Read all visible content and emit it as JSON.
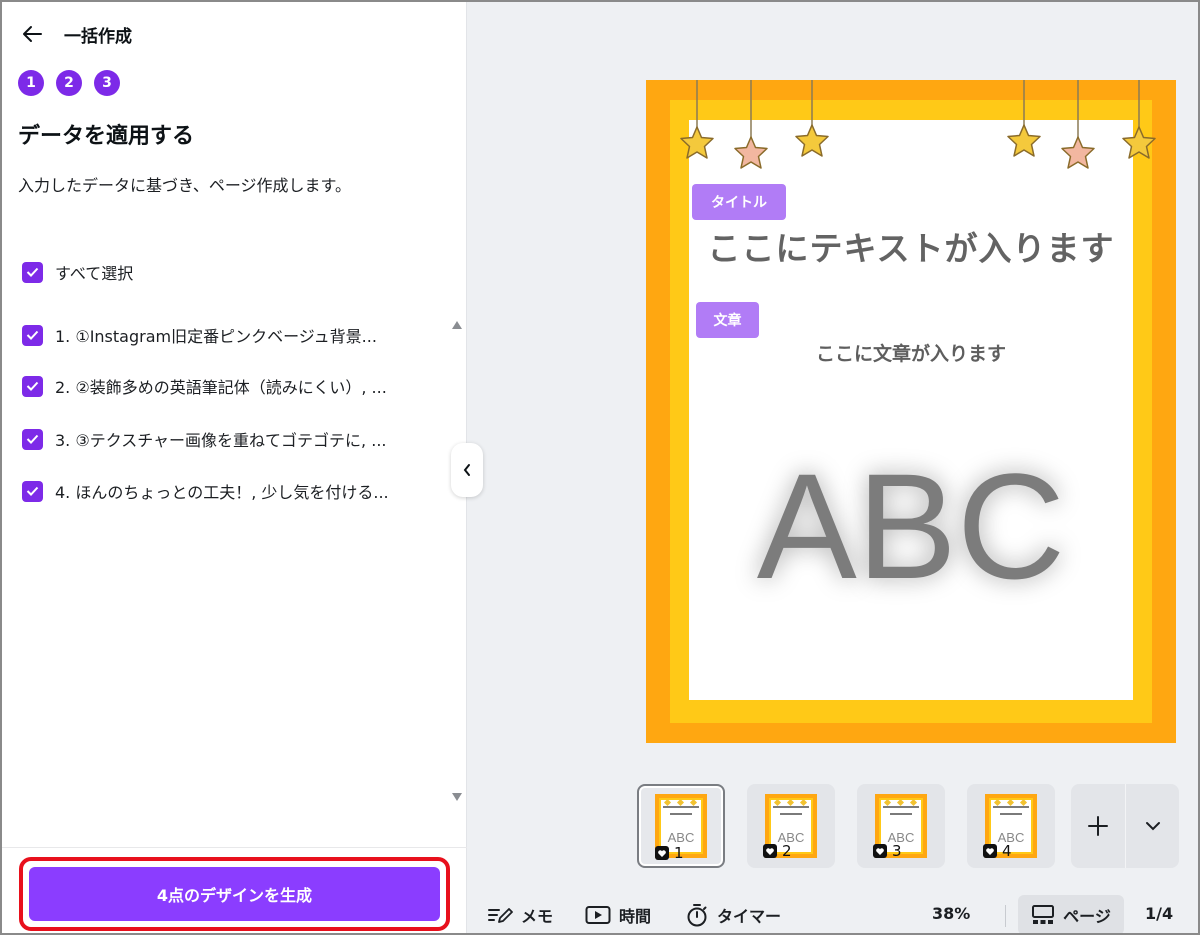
{
  "header": {
    "back_icon": "arrow-left-icon",
    "title": "一括作成"
  },
  "steps": [
    "1",
    "2",
    "3"
  ],
  "panel": {
    "heading": "データを適用する",
    "description": "入力したデータに基づき、ページ作成します。",
    "select_all": "すべて選択",
    "items": [
      "1. ①Instagram旧定番ピンクベージュ背景...",
      "2. ②装飾多めの英語筆記体（読みにくい）, ...",
      "3. ③テクスチャー画像を重ねてゴテゴテに, ...",
      "4. ほんのちょっとの工夫！, 少し気を付ける..."
    ],
    "generate_button": "4点のデザインを生成"
  },
  "canvas": {
    "title_label": "タイトル",
    "title_text": "ここにテキストが入ります",
    "body_label": "文章",
    "body_text": "ここに文章が入ります",
    "big_text": "ABC"
  },
  "thumbnails": [
    "1",
    "2",
    "3",
    "4"
  ],
  "toolbar": {
    "memo": "メモ",
    "time": "時間",
    "timer": "タイマー",
    "zoom": "38%",
    "pages": "ページ",
    "page_indicator": "1/4"
  },
  "colors": {
    "accent": "#7d2ae8",
    "button": "#8b3dff",
    "highlight": "#e8101c",
    "frame_orange": "#ffa711",
    "frame_yellow": "#ffc917"
  }
}
